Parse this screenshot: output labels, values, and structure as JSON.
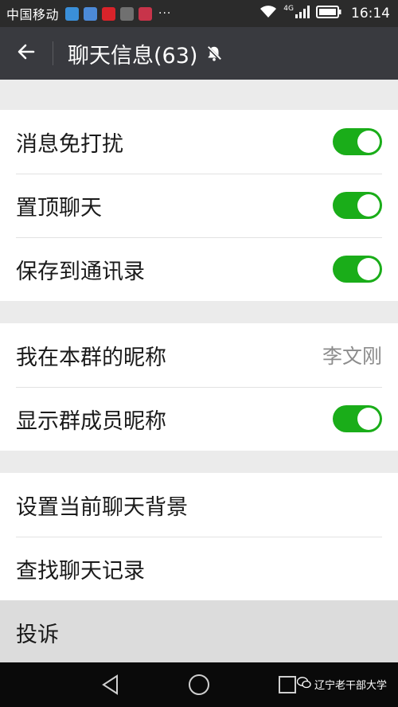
{
  "status_bar": {
    "carrier": "中国移动",
    "more": "···",
    "network": "4G",
    "time": "16:14"
  },
  "header": {
    "title": "聊天信息(63)",
    "back_icon": "back-arrow-icon",
    "mute_icon": "bell-off-icon"
  },
  "groups": [
    {
      "rows": [
        {
          "label": "消息免打扰",
          "toggle": true
        },
        {
          "label": "置顶聊天",
          "toggle": true
        },
        {
          "label": "保存到通讯录",
          "toggle": true
        }
      ]
    },
    {
      "rows": [
        {
          "label": "我在本群的昵称",
          "value": "李文刚"
        },
        {
          "label": "显示群成员昵称",
          "toggle": true
        }
      ]
    },
    {
      "rows": [
        {
          "label": "设置当前聊天背景"
        },
        {
          "label": "查找聊天记录"
        },
        {
          "label": "投诉"
        }
      ]
    }
  ],
  "watermark": "辽宁老干部大学",
  "colors": {
    "toggle_on": "#1aad19",
    "title_bar": "#393a3f",
    "status_bar": "#2b2b2b",
    "background": "#ebebeb"
  }
}
